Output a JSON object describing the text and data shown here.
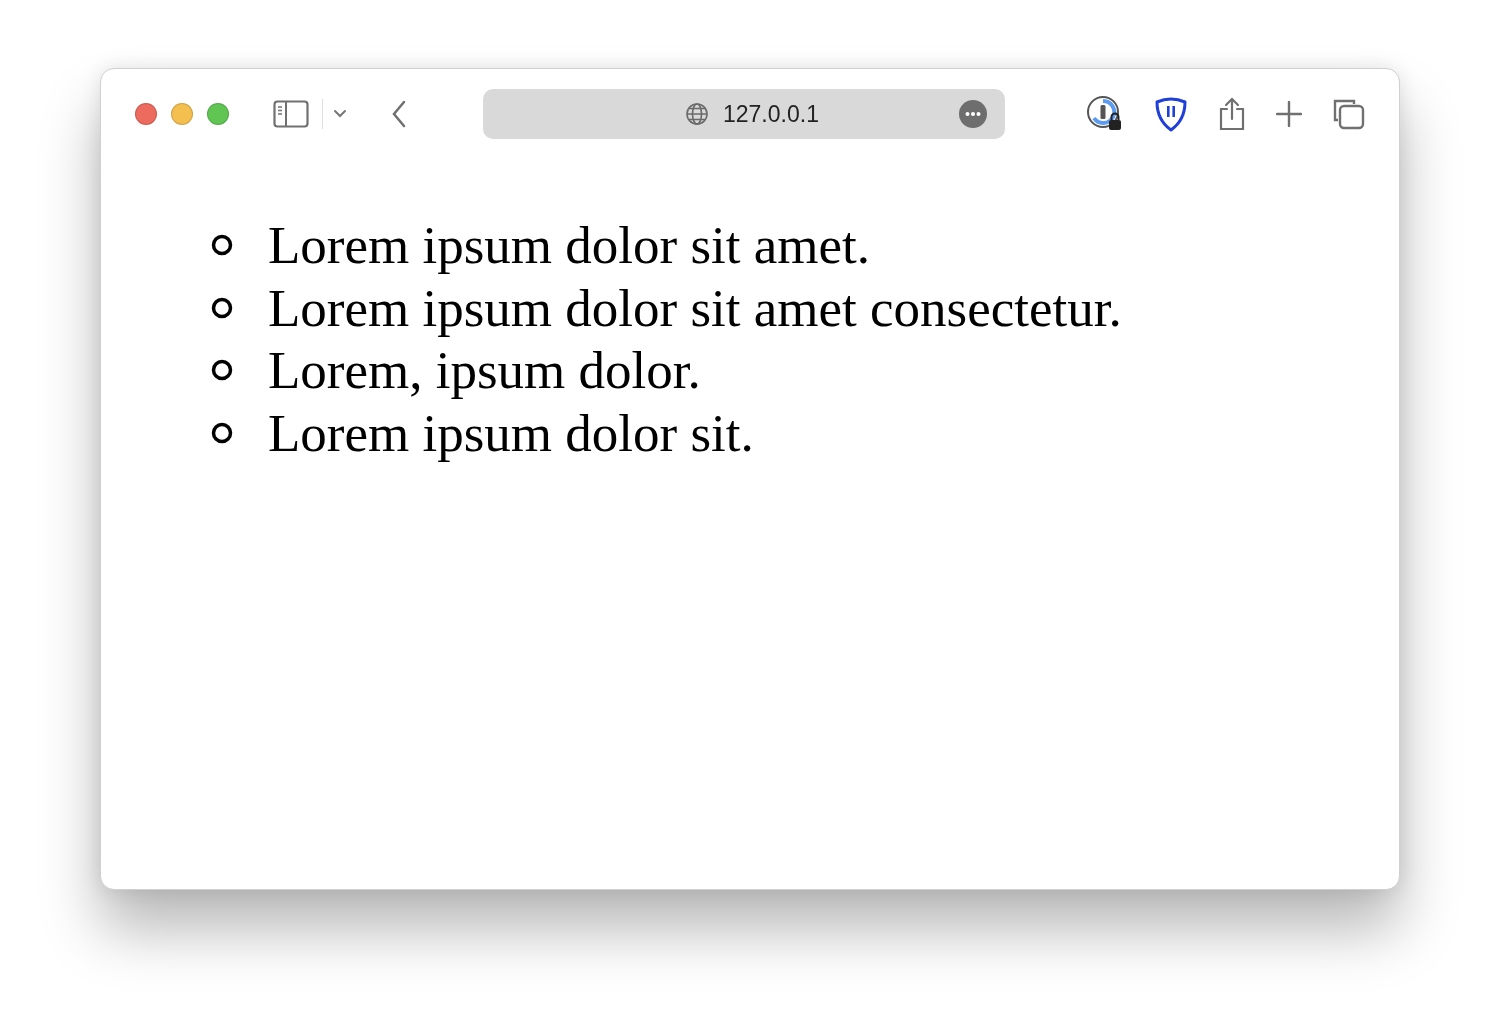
{
  "address_bar": {
    "url": "127.0.0.1"
  },
  "list": [
    "Lorem ipsum dolor sit amet.",
    "Lorem ipsum dolor sit amet consectetur.",
    "Lorem, ipsum dolor.",
    "Lorem ipsum dolor sit."
  ]
}
